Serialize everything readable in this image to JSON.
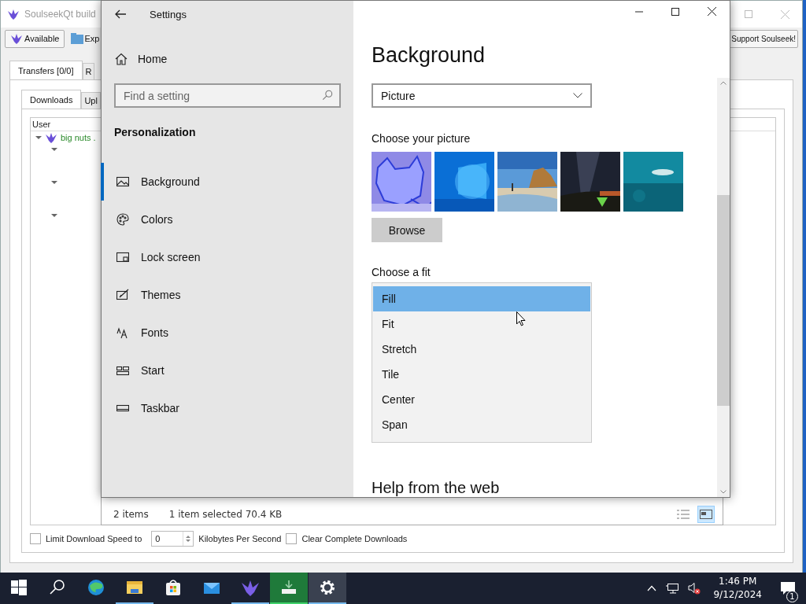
{
  "soulseek": {
    "title": "SoulseekQt build",
    "status_button": "Available",
    "toolbar_button": "Exp",
    "support_button": "Support Soulseek!",
    "tabs": [
      {
        "label": "Transfers [0/0]",
        "selected": true
      },
      {
        "label": "R",
        "selected": false
      }
    ],
    "subtabs": [
      {
        "label": "Downloads",
        "selected": true
      },
      {
        "label": "Upl",
        "selected": false
      }
    ],
    "column": "User",
    "rows": [
      {
        "user": "big nuts .",
        "expanded": true,
        "children": [
          {
            "expanded": true
          },
          {
            "expanded": true
          },
          {
            "expanded": true
          }
        ]
      }
    ],
    "limit_speed": {
      "label": "Limit Download Speed to",
      "checked": false,
      "value": "0",
      "unit": "Kilobytes Per Second"
    },
    "clear_complete": {
      "label": "Clear Complete Downloads",
      "checked": false
    }
  },
  "explorer_status": {
    "item_count": "2 items",
    "selection": "1 item selected  70.4 KB",
    "views": [
      {
        "kind": "details",
        "selected": false
      },
      {
        "kind": "tiles",
        "selected": true
      }
    ]
  },
  "settings": {
    "title": "Settings",
    "home": "Home",
    "search": {
      "placeholder": "Find a setting"
    },
    "section": "Personalization",
    "nav": [
      {
        "label": "Background",
        "kind": "picture",
        "selected": true
      },
      {
        "label": "Colors",
        "kind": "palette",
        "selected": false
      },
      {
        "label": "Lock screen",
        "kind": "lock",
        "selected": false
      },
      {
        "label": "Themes",
        "kind": "themes",
        "selected": false
      },
      {
        "label": "Fonts",
        "kind": "fonts",
        "selected": false
      },
      {
        "label": "Start",
        "kind": "start",
        "selected": false
      },
      {
        "label": "Taskbar",
        "kind": "taskbar",
        "selected": false
      }
    ],
    "page": {
      "title": "Background",
      "background_select": "Picture",
      "choose_picture_label": "Choose your picture",
      "browse": "Browse",
      "fit_label": "Choose a fit",
      "fit_options": [
        {
          "label": "Fill",
          "selected": true
        },
        {
          "label": "Fit",
          "selected": false
        },
        {
          "label": "Stretch",
          "selected": false
        },
        {
          "label": "Tile",
          "selected": false
        },
        {
          "label": "Center",
          "selected": false
        },
        {
          "label": "Span",
          "selected": false
        }
      ],
      "help_heading": "Help from the web"
    }
  },
  "taskbar": {
    "apps": [
      {
        "kind": "start",
        "running": false,
        "active": false
      },
      {
        "kind": "search",
        "running": false,
        "active": false
      },
      {
        "kind": "edge",
        "running": false,
        "active": false
      },
      {
        "kind": "folder",
        "running": true,
        "active": false
      },
      {
        "kind": "store",
        "running": false,
        "active": false
      },
      {
        "kind": "mail",
        "running": false,
        "active": false
      },
      {
        "kind": "bird",
        "running": true,
        "active": false
      },
      {
        "kind": "download",
        "running": true,
        "active": false,
        "flashing": true
      },
      {
        "kind": "settings",
        "running": true,
        "active": true
      }
    ],
    "time": "1:46 PM",
    "date": "9/12/2024",
    "notifications": "1"
  }
}
